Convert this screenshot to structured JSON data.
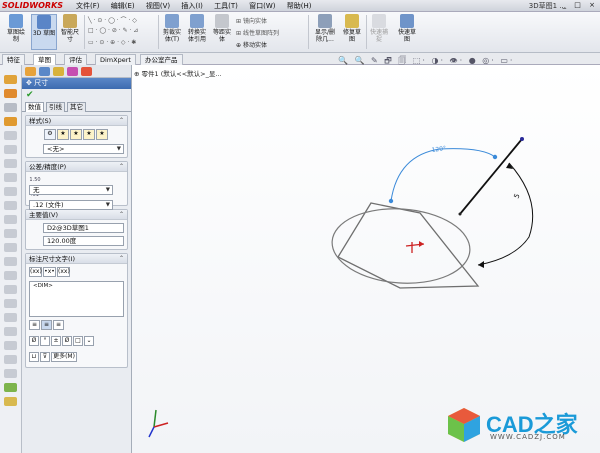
{
  "app": {
    "logo": "SOLIDWORKS",
    "window_title": "3D草图1 ...",
    "win_controls": "_ □ ×"
  },
  "menus": [
    "文件(F)",
    "编辑(E)",
    "视图(V)",
    "插入(I)",
    "工具(T)",
    "窗口(W)",
    "帮助(H)"
  ],
  "ribbon": {
    "big_buttons": [
      {
        "label": "草图绘\n制",
        "name": "sketch-button"
      },
      {
        "label": "3D 草图",
        "name": "3d-sketch-button",
        "selected": true
      },
      {
        "label": "智能尺\n寸",
        "name": "smart-dimension-button"
      },
      {
        "label": "剪裁实\n体(T)",
        "name": "trim-button"
      },
      {
        "label": "转换实\n体引用",
        "name": "convert-button"
      },
      {
        "label": "等距实\n体",
        "name": "offset-button"
      },
      {
        "label": "显示/删\n除几...",
        "name": "display-relations-button"
      },
      {
        "label": "修复草\n图",
        "name": "repair-sketch-button"
      },
      {
        "label": "快速捕\n捉",
        "name": "quick-snap-button"
      },
      {
        "label": "快速草\n图",
        "name": "rapid-sketch-button"
      }
    ],
    "small_items": [
      "镜向实体",
      "线性草图阵列",
      "移动实体"
    ]
  },
  "cmd_tabs": [
    "特征",
    "草图",
    "评估",
    "DimXpert",
    "办公室产品"
  ],
  "view_tools": "🔍 🔍 ✎ 🗗 🗐 ⬚· ◑· 👁· ● ◎· ▭·",
  "pm": {
    "title": "尺寸",
    "sub_tabs": [
      "数值",
      "引线",
      "其它"
    ],
    "style": {
      "header": "样式(S)",
      "value": "<无>"
    },
    "tolerance": {
      "header": "公差/精度(P)",
      "tol_value": "无",
      "precision_value": ".12 (文件)"
    },
    "primary": {
      "header": "主要值(V)",
      "name_value": "D2@3D草图1",
      "angle_value": "120.00度"
    },
    "dimtext": {
      "header": "标注尺寸文字(I)",
      "text_value": "<DIM>",
      "more_button": "更多(M)",
      "tags": [
        "(xx)",
        "•x•",
        "(xx)"
      ],
      "symbols": [
        "Ø",
        "°",
        "±",
        "Ø",
        "□"
      ]
    }
  },
  "model": {
    "tree_label": "零件1 (默认<<默认>_显..."
  },
  "dimension": {
    "angle_text": "120°",
    "length_text": "5"
  },
  "watermark": {
    "text": "CAD之家",
    "url": "WWW.CADZJ.COM"
  },
  "colors": {
    "accent": "#3d6bb0",
    "dim_blue": "#3b8ad9",
    "sketch": "#555555",
    "watermark": "#1a9ad8"
  }
}
